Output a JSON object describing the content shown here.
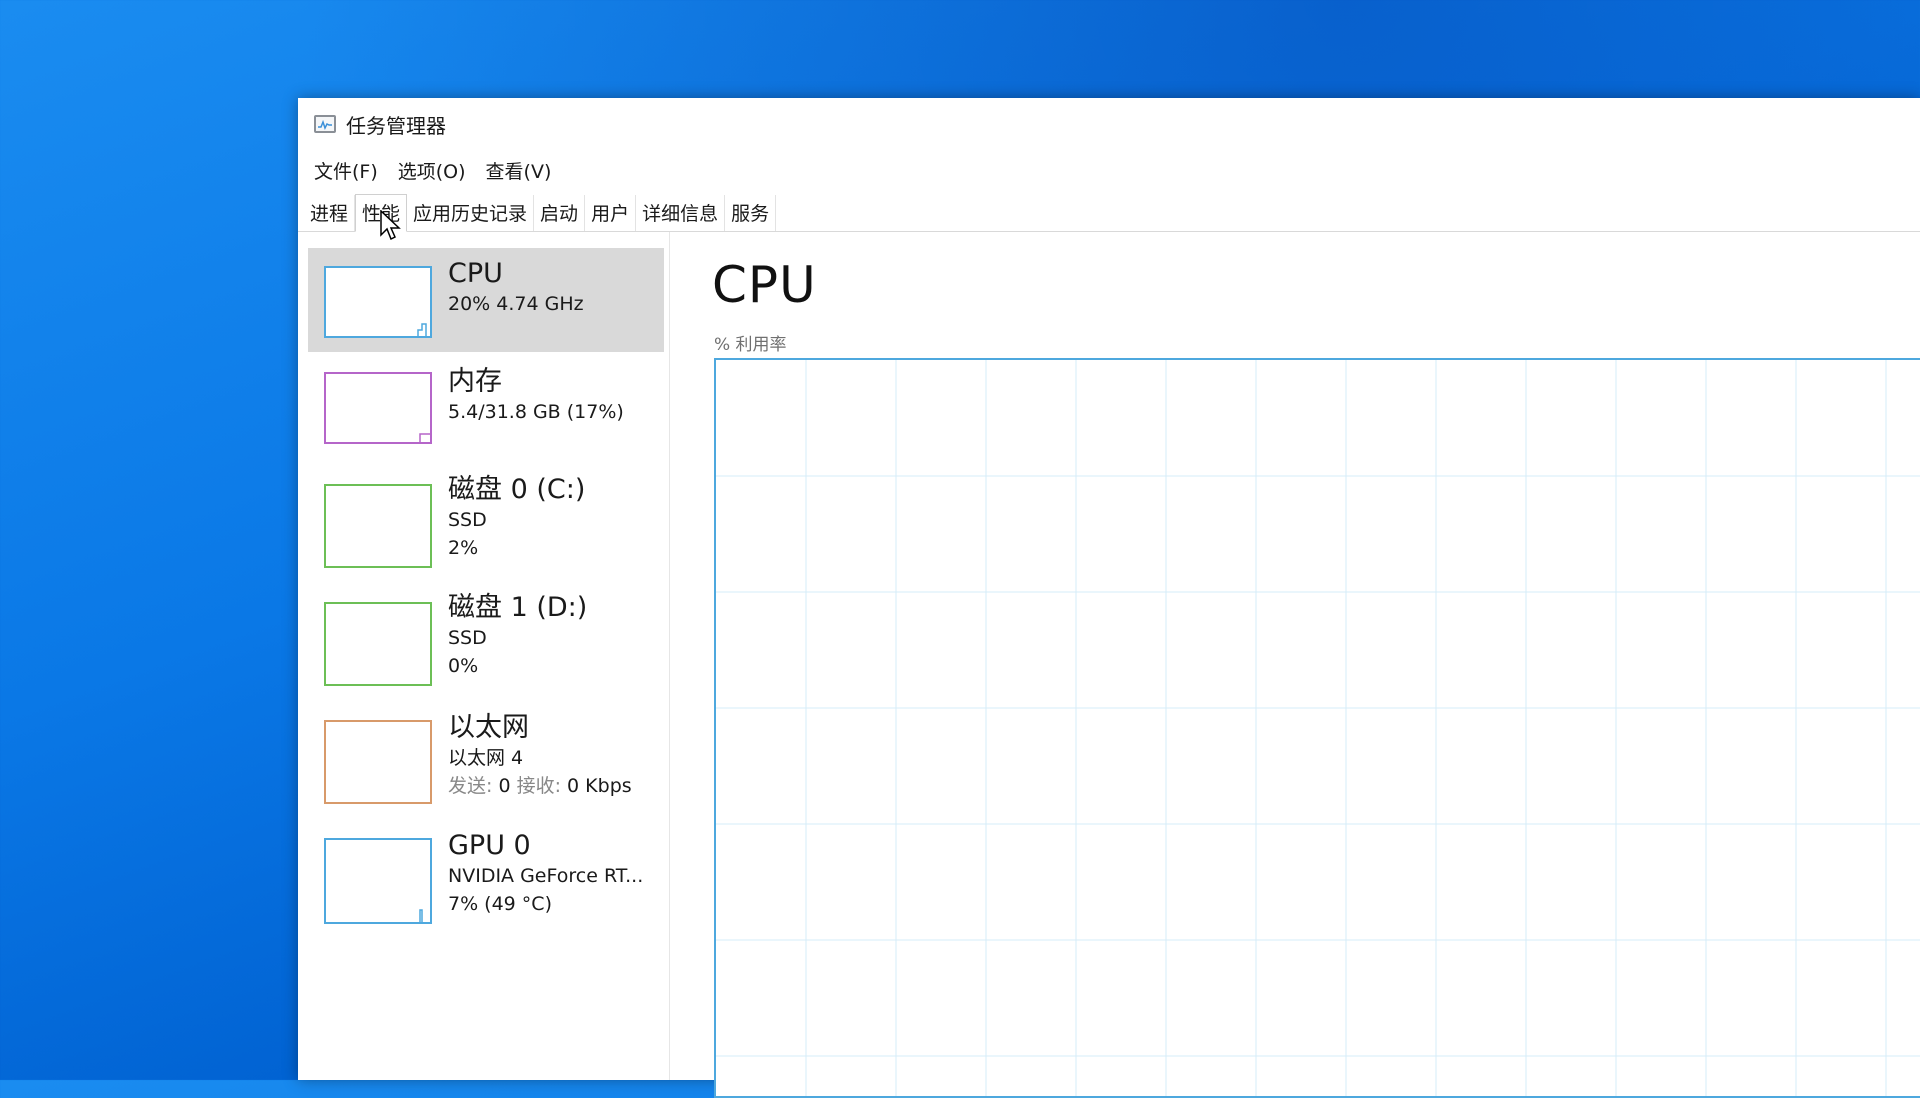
{
  "window": {
    "title": "任务管理器"
  },
  "menu": {
    "items": [
      "文件(F)",
      "选项(O)",
      "查看(V)"
    ]
  },
  "tabs": {
    "items": [
      "进程",
      "性能",
      "应用历史记录",
      "启动",
      "用户",
      "详细信息",
      "服务"
    ],
    "active_index": 1
  },
  "resources": [
    {
      "name": "CPU",
      "lines": [
        "20% 4.74 GHz"
      ],
      "color": "#4ea8de",
      "selected": true
    },
    {
      "name": "内存",
      "lines": [
        "5.4/31.8 GB (17%)"
      ],
      "color": "#b565c9",
      "selected": false
    },
    {
      "name": "磁盘 0 (C:)",
      "lines": [
        "SSD",
        "2%"
      ],
      "color": "#6cbf56",
      "selected": false
    },
    {
      "name": "磁盘 1 (D:)",
      "lines": [
        "SSD",
        "0%"
      ],
      "color": "#6cbf56",
      "selected": false
    },
    {
      "name": "以太网",
      "lines": [
        "以太网 4"
      ],
      "net": {
        "send_label": "发送:",
        "send_value": "0",
        "recv_label": "接收:",
        "recv_value": "0 Kbps"
      },
      "color": "#d89a6a",
      "selected": false
    },
    {
      "name": "GPU 0",
      "lines": [
        "NVIDIA GeForce RT...",
        "7% (49 °C)"
      ],
      "color": "#4ea8de",
      "selected": false
    }
  ],
  "main": {
    "title": "CPU",
    "util_label": "% 利用率"
  },
  "colors": {
    "graph_border": "#4ea8de",
    "graph_grid": "#d6ecf8",
    "selected_bg": "#d9d9d9"
  }
}
